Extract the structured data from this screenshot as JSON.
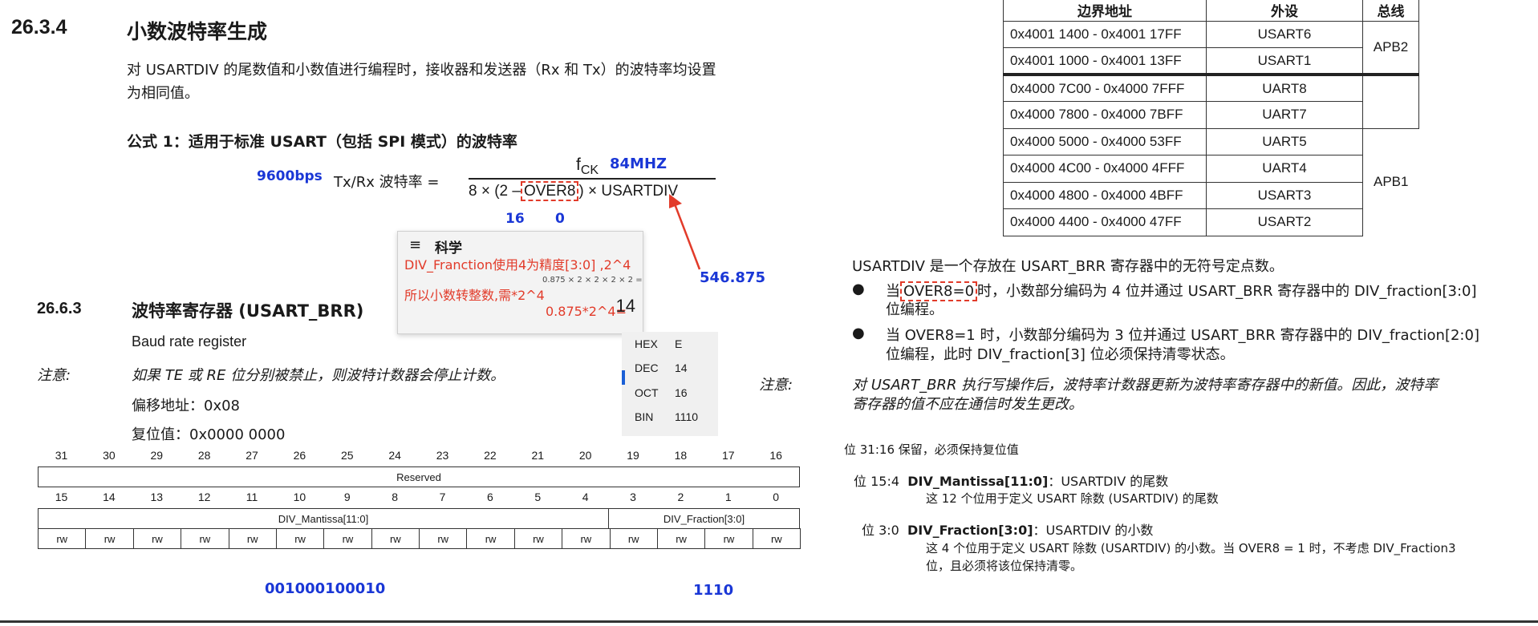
{
  "left": {
    "section1": {
      "num": "26.3.4",
      "title": "小数波特率生成"
    },
    "para1_line1": "对 USARTDIV 的尾数值和小数值进行编程时，接收器和发送器（Rx 和 Tx）的波特率均设置",
    "para1_line2": "为相同值。",
    "formula_heading": "公式 1：适用于标准 USART（包括 SPI 模式）的波特率",
    "formula": {
      "baud_annot": "9600bps",
      "lhs": "Tx/Rx 波特率  =",
      "numerator": "f",
      "numerator_sub": "CK",
      "fck_annot": "84MHZ",
      "denom_pre": "8 × (2 –",
      "denom_over8": "OVER8",
      "denom_post": ") × USARTDIV",
      "annot_16": "16",
      "annot_0": "0",
      "annot_result": "546.875"
    },
    "section2": {
      "num": "26.6.3",
      "title": "波特率寄存器 (USART_BRR)"
    },
    "baud_register": "Baud rate register",
    "note_label": "注意:",
    "note_text": "如果 TE 或 RE 位分别被禁止，则波特计数器会停止计数。",
    "offset": "偏移地址：0x08",
    "reset": "复位值：0x0000 0000",
    "bits_top": [
      "31",
      "30",
      "29",
      "28",
      "27",
      "26",
      "25",
      "24",
      "23",
      "22",
      "21",
      "20",
      "19",
      "18",
      "17",
      "16"
    ],
    "reserved": "Reserved",
    "bits_bottom": [
      "15",
      "14",
      "13",
      "12",
      "11",
      "10",
      "9",
      "8",
      "7",
      "6",
      "5",
      "4",
      "3",
      "2",
      "1",
      "0"
    ],
    "mantissa_field": "DIV_Mantissa[11:0]",
    "fraction_field": "DIV_Fraction[3:0]",
    "access": "rw",
    "mantissa_bin": "001000100010",
    "fraction_bin": "1110"
  },
  "calculator": {
    "menu_icon": "≡",
    "title": "科学",
    "note1": "DIV_Franction使用4为精度[3:0] ,2^4",
    "note2": "所以小数转整数,需*2^4",
    "expr": "0.875 × 2 × 2 × 2 × 2 =",
    "note3": "0.875*2^4=",
    "result": "14",
    "prog": [
      {
        "k": "HEX",
        "v": "E"
      },
      {
        "k": "DEC",
        "v": "14"
      },
      {
        "k": "OCT",
        "v": "16"
      },
      {
        "k": "BIN",
        "v": "1110"
      }
    ]
  },
  "right": {
    "table_headers": [
      "边界地址",
      "外设",
      "总线"
    ],
    "rows": [
      {
        "addr": "0x4001 1400 - 0x4001 17FF",
        "periph": "USART6"
      },
      {
        "addr": "0x4001 1000 - 0x4001 13FF",
        "periph": "USART1"
      },
      {
        "addr": "0x4000 7C00 - 0x4000 7FFF",
        "periph": "UART8"
      },
      {
        "addr": "0x4000 7800 - 0x4000 7BFF",
        "periph": "UART7"
      },
      {
        "addr": "0x4000 5000 - 0x4000 53FF",
        "periph": "UART5"
      },
      {
        "addr": "0x4000 4C00 - 0x4000 4FFF",
        "periph": "UART4"
      },
      {
        "addr": "0x4000 4800 - 0x4000 4BFF",
        "periph": "USART3"
      },
      {
        "addr": "0x4000 4400 - 0x4000 47FF",
        "periph": "USART2"
      }
    ],
    "bus_apb2": "APB2",
    "bus_apb1": "APB1",
    "usartdiv_desc": "USARTDIV 是一个存放在 USART_BRR 寄存器中的无符号定点数。",
    "bullet1_pre": "当",
    "bullet1_over8": "OVER8=0",
    "bullet1_post": "时，小数部分编码为 4 位并通过 USART_BRR 寄存器中的 DIV_fraction[3:0]",
    "bullet1_line2": "位编程。",
    "bullet2_line1": "当 OVER8=1 时，小数部分编码为 3 位并通过 USART_BRR 寄存器中的 DIV_fraction[2:0]",
    "bullet2_line2": "位编程，此时 DIV_fraction[3] 位必须保持清零状态。",
    "note_label": "注意:",
    "note_line1": "对 USART_BRR 执行写操作后，波特率计数器更新为波特率寄存器中的新值。因此，波特率",
    "note_line2": "寄存器的值不应在通信时发生更改。",
    "bits3116": "位 31:16  保留，必须保持复位值",
    "bits154_label": "位 15:4",
    "bits154_name": "DIV_Mantissa[11:0]",
    "bits154_tail": "：USARTDIV 的尾数",
    "bits154_desc": "这 12 个位用于定义 USART 除数 (USARTDIV) 的尾数",
    "bits30_label": "位 3:0",
    "bits30_name": "DIV_Fraction[3:0]",
    "bits30_tail": "：USARTDIV 的小数",
    "bits30_desc1": "这 4 个位用于定义 USART 除数 (USARTDIV) 的小数。当 OVER8 = 1 时，不考虑 DIV_Fraction3",
    "bits30_desc2": "位，且必须将该位保持清零。"
  }
}
